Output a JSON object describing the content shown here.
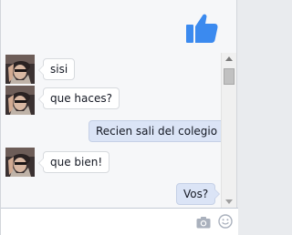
{
  "colors": {
    "accent": "#3b8aef",
    "bubble_out": "#dbe4f6",
    "bubble_in": "#ffffff",
    "background": "#f6f7f9"
  },
  "messages": [
    {
      "sender": "other",
      "text": "sisi"
    },
    {
      "sender": "other",
      "text": "que haces?"
    },
    {
      "sender": "me",
      "text": "Recien sali del colegio"
    },
    {
      "sender": "other",
      "text": "que bien!"
    },
    {
      "sender": "me",
      "text": "Vos?"
    }
  ],
  "composer": {
    "placeholder": "",
    "value": ""
  },
  "icons": {
    "like": "thumbs-up-icon",
    "camera": "camera-icon",
    "emoji": "emoji-icon"
  }
}
